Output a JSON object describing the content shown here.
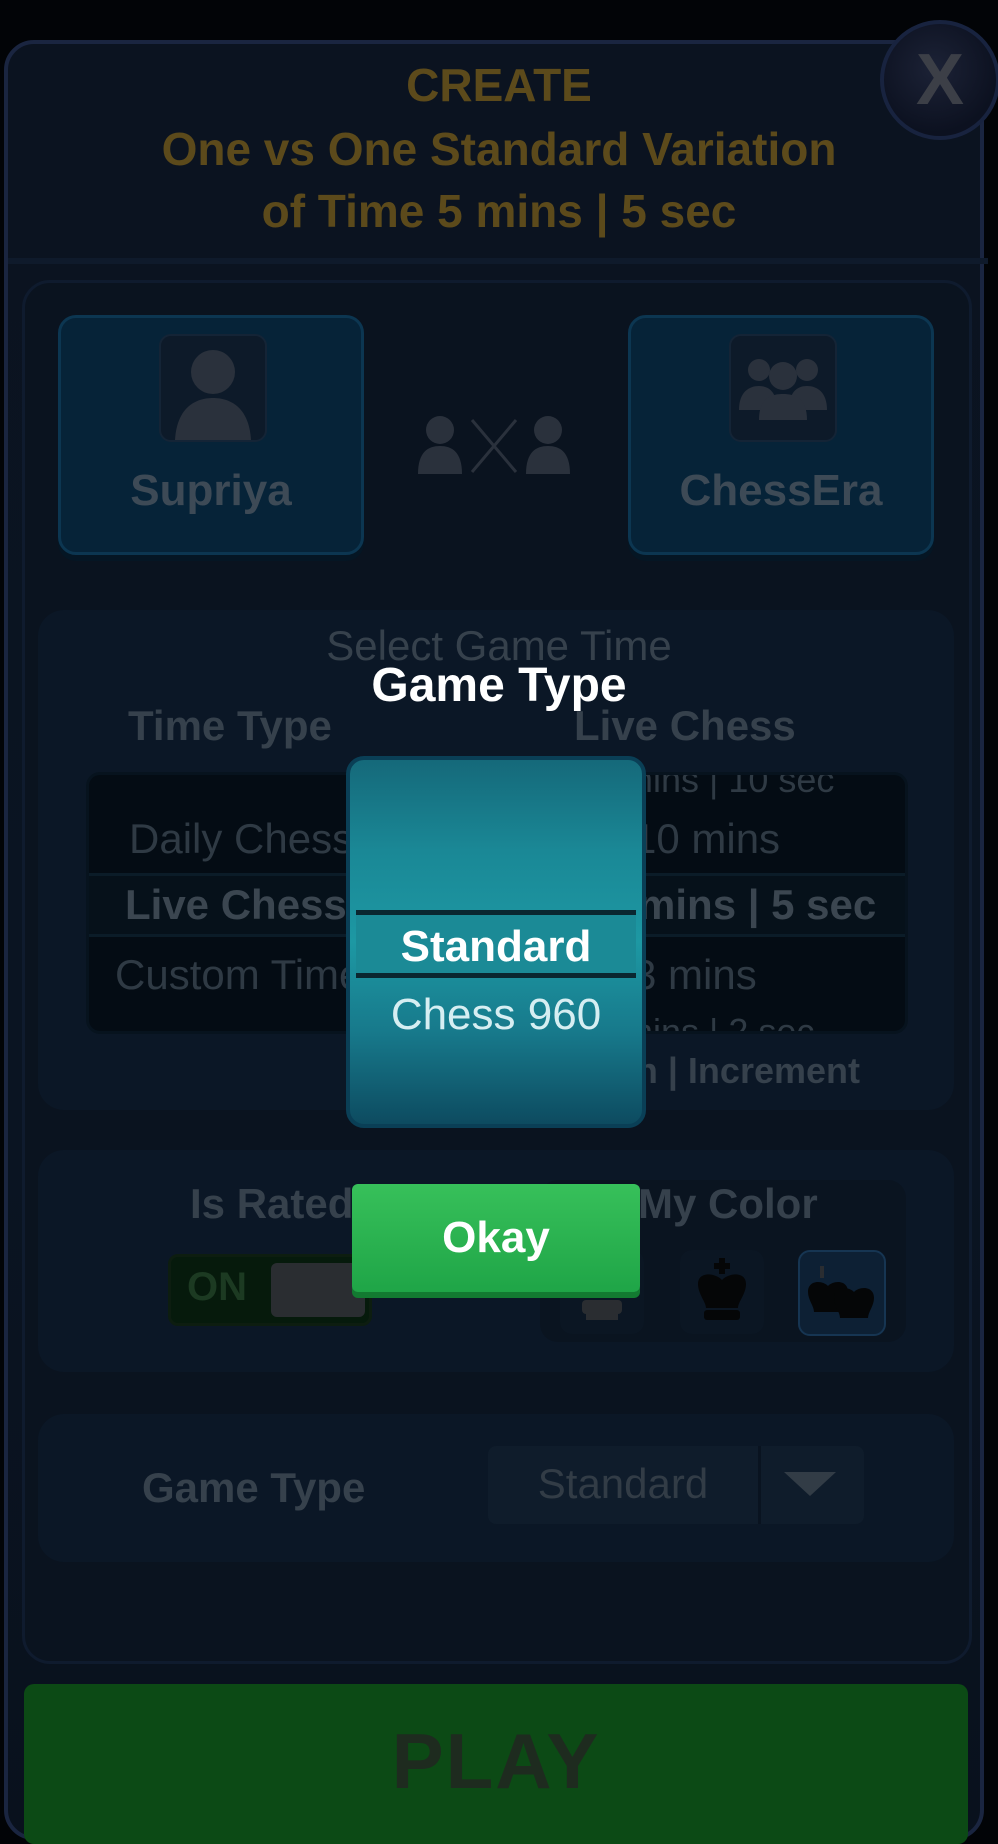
{
  "header": {
    "title": "CREATE",
    "subtitle_line1": "One vs One Standard Variation",
    "subtitle_line2": "of Time 5 mins | 5 sec"
  },
  "close_label": "X",
  "players": {
    "left_name": "Supriya",
    "right_name": "ChessEra"
  },
  "game_time": {
    "section_title": "Select Game Time",
    "time_type_label": "Time Type",
    "time_value_label": "Live Chess",
    "time_types": [
      "Daily Chess",
      "Live Chess",
      "Custom Time"
    ],
    "time_options_top": "mins | 10 sec",
    "time_options": [
      "10 mins",
      "5 mins | 5 sec",
      "3 mins"
    ],
    "time_options_bottom": "mins | 2 sec",
    "footer": "Min | Increment"
  },
  "rated": {
    "label": "Is Rated",
    "toggle": "ON"
  },
  "color": {
    "label": "My Color"
  },
  "game_type_row": {
    "label": "Game Type",
    "selected": "Standard"
  },
  "modal": {
    "title": "Game Type",
    "options": [
      "Standard",
      "Chess 960"
    ],
    "okay_label": "Okay"
  },
  "play_label": "PLAY"
}
